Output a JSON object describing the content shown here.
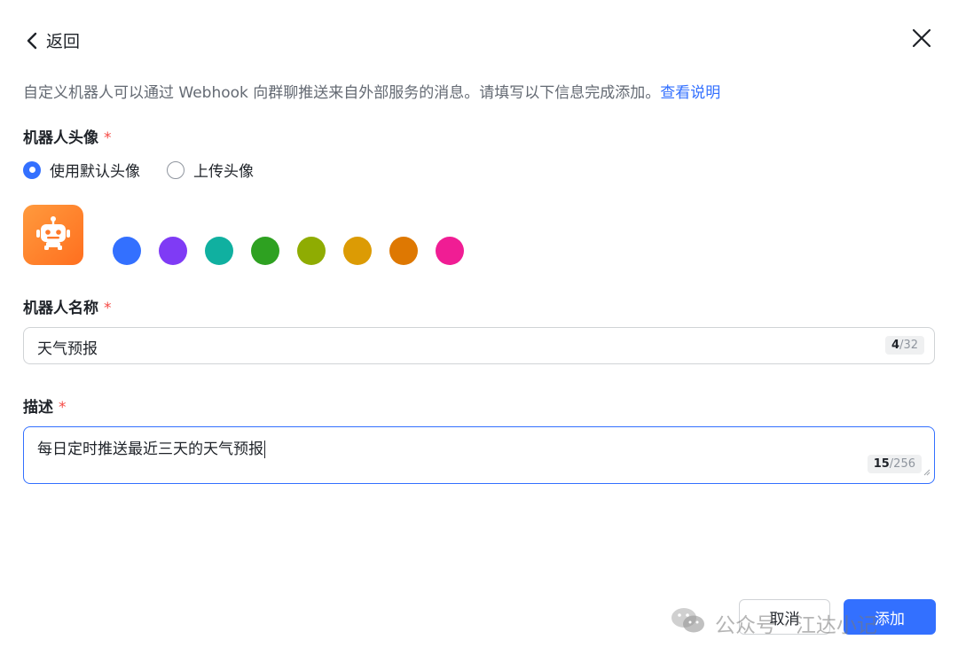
{
  "header": {
    "back_label": "返回"
  },
  "description": {
    "text": "自定义机器人可以通过 Webhook 向群聊推送来自外部服务的消息。请填写以下信息完成添加。",
    "link_label": "查看说明"
  },
  "avatar_section": {
    "label": "机器人头像",
    "required_mark": "*",
    "options": [
      {
        "label": "使用默认头像",
        "checked": true
      },
      {
        "label": "上传头像",
        "checked": false
      }
    ],
    "colors": [
      "#3370ff",
      "#7f3bf5",
      "#10b0a0",
      "#2ea121",
      "#8fac02",
      "#dc9b04",
      "#de7802",
      "#f01d94"
    ]
  },
  "name_field": {
    "label": "机器人名称",
    "required_mark": "*",
    "value": "天气预报",
    "count_current": "4",
    "count_max": "/32"
  },
  "desc_field": {
    "label": "描述",
    "required_mark": "*",
    "value": "每日定时推送最近三天的天气预报",
    "count_current": "15",
    "count_max": "/256"
  },
  "footer": {
    "cancel_label": "取消",
    "add_label": "添加"
  },
  "watermark": {
    "text": "公众号 · 江达小记"
  },
  "colors": {
    "accent": "#3370ff",
    "required": "#f54a45",
    "avatar_bg": "#ff7a2a"
  },
  "icons": {
    "back": "chevron-left-icon",
    "close": "close-icon",
    "robot": "robot-icon"
  }
}
